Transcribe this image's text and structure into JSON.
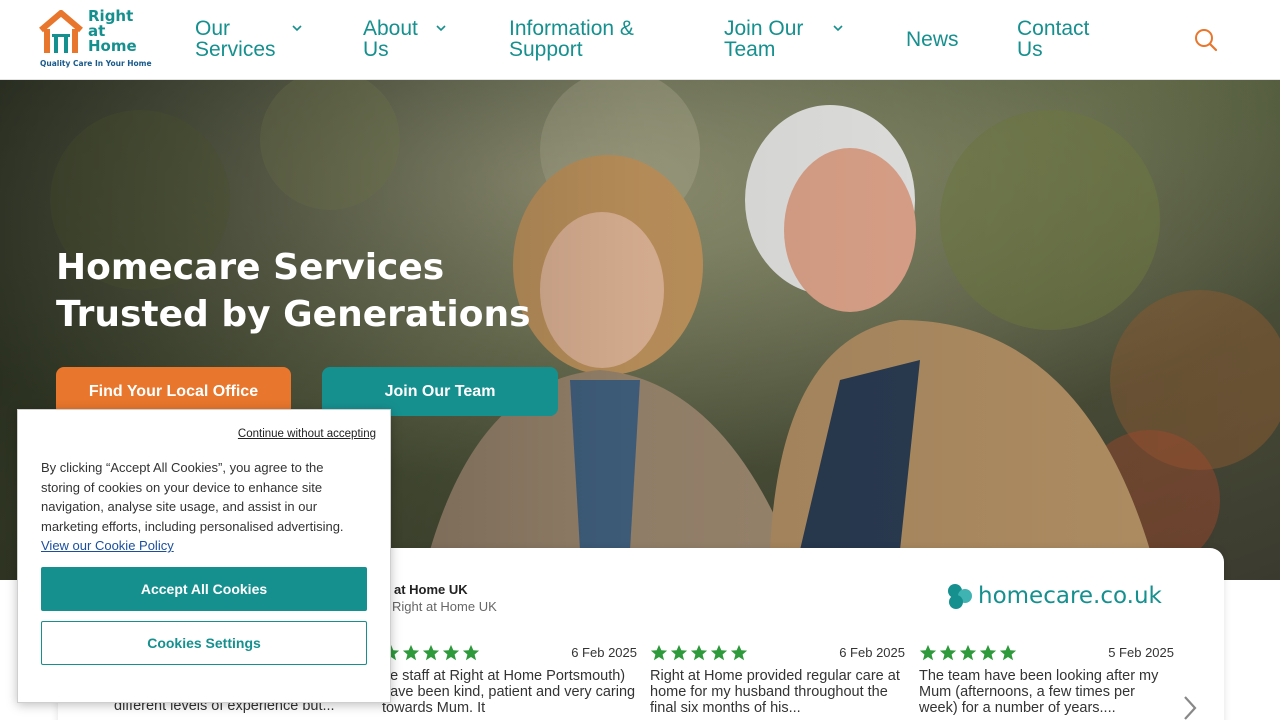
{
  "header": {
    "logo": {
      "line1": "Right",
      "line2": "at",
      "line3": "Home",
      "tagline": "Quality Care In Your Home"
    },
    "nav": [
      {
        "line1": "Our",
        "line2": "Services",
        "has_dropdown": true
      },
      {
        "line1": "About",
        "line2": "Us",
        "has_dropdown": true
      },
      {
        "line1": "Information &",
        "line2": "Support",
        "has_dropdown": false
      },
      {
        "line1": "Join Our",
        "line2": "Team",
        "has_dropdown": true
      },
      {
        "line1": "News",
        "line2": "",
        "has_dropdown": false
      },
      {
        "line1": "Contact",
        "line2": "Us",
        "has_dropdown": false
      }
    ],
    "search_icon": "search-icon"
  },
  "hero": {
    "title_line1": "Homecare Services",
    "title_line2": "Trusted by Generations",
    "primary_button": "Find Your Local Office",
    "secondary_button": "Join Our Team"
  },
  "reviews": {
    "source_name": "at Home UK",
    "source_sub": "Right at Home UK",
    "provider_logo": "homecare.co.uk",
    "partial_text": "different levels of experience but...",
    "items": [
      {
        "rating": 5,
        "date": "6 Feb 2025",
        "text": "he staff at Right at Home Portsmouth) have been kind, patient and very caring towards Mum. It"
      },
      {
        "rating": 5,
        "date": "6 Feb 2025",
        "text": "Right at Home provided regular care at home for my husband throughout the final six months of his..."
      },
      {
        "rating": 5,
        "date": "5 Feb 2025",
        "text": "The team have been looking after my Mum (afternoons, a few times per week) for a number of years...."
      }
    ]
  },
  "cookie": {
    "continue_link": "Continue without accepting",
    "body": "By clicking “Accept All Cookies”, you agree to the storing of cookies on your device to enhance site navigation, analyse site usage, and assist in our marketing efforts, including personalised advertising.",
    "policy_link": "View our Cookie Policy",
    "accept_button": "Accept All Cookies",
    "settings_button": "Cookies Settings"
  },
  "colors": {
    "teal": "#16908f",
    "orange": "#e8762c",
    "star_green": "#2e9a3c"
  }
}
